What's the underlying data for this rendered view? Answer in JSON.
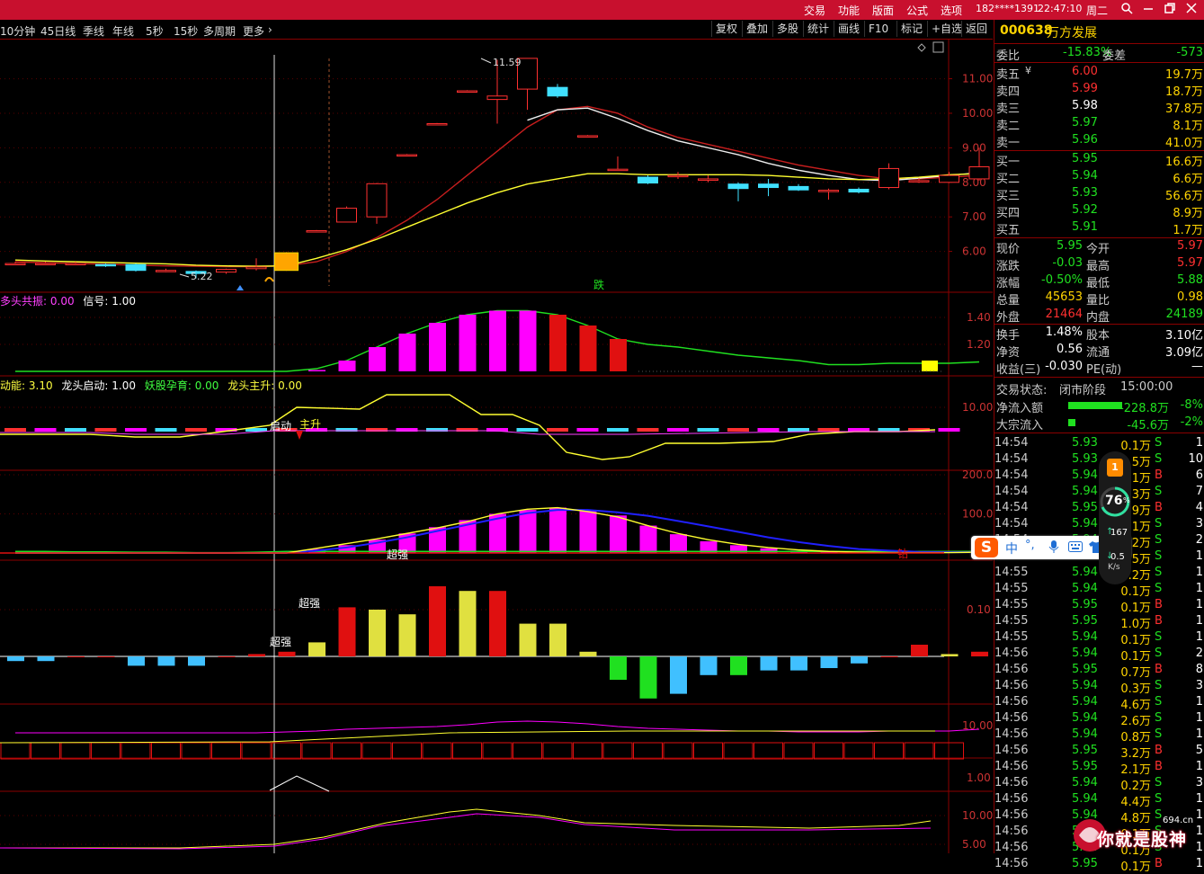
{
  "titlebar": {
    "menus": [
      "交易",
      "功能",
      "版面",
      "公式",
      "选项"
    ],
    "user": "182****1391",
    "time": "22:47:10",
    "weekday": "周二",
    "icons": [
      "search-icon",
      "minimize-icon",
      "restore-icon",
      "close-icon"
    ]
  },
  "periods": [
    "10分钟",
    "45日线",
    "季线",
    "年线",
    "5秒",
    "15秒",
    "多周期",
    "更多"
  ],
  "toolbar_buttons": [
    "复权",
    "叠加",
    "多股",
    "统计",
    "画线",
    "F10",
    "标记",
    "+自选",
    "返回"
  ],
  "stock": {
    "code": "000638",
    "name": "万方发展"
  },
  "weibi": {
    "label1": "委比",
    "v1": "-15.83%",
    "label2": "委差",
    "v2": "-573"
  },
  "asks": [
    {
      "label": "卖五",
      "yen": "¥",
      "price": "6.00",
      "vol": "19.7万"
    },
    {
      "label": "卖四",
      "price": "5.99",
      "vol": "18.7万"
    },
    {
      "label": "卖三",
      "price": "5.98",
      "vol": "37.8万"
    },
    {
      "label": "卖二",
      "price": "5.97",
      "vol": "8.1万"
    },
    {
      "label": "卖一",
      "price": "5.96",
      "vol": "41.0万"
    }
  ],
  "bids": [
    {
      "label": "买一",
      "price": "5.95",
      "vol": "16.6万"
    },
    {
      "label": "买二",
      "price": "5.94",
      "vol": "6.6万"
    },
    {
      "label": "买三",
      "price": "5.93",
      "vol": "56.6万"
    },
    {
      "label": "买四",
      "price": "5.92",
      "vol": "8.9万"
    },
    {
      "label": "买五",
      "price": "5.91",
      "vol": "1.7万"
    }
  ],
  "quote": [
    {
      "l1": "现价",
      "v1": "5.95",
      "l2": "今开",
      "v2": "5.97"
    },
    {
      "l1": "涨跌",
      "v1": "-0.03",
      "l2": "最高",
      "v2": "5.97"
    },
    {
      "l1": "涨幅",
      "v1": "-0.50%",
      "l2": "最低",
      "v2": "5.88"
    },
    {
      "l1": "总量",
      "v1": "45653",
      "l2": "量比",
      "v2": "0.98"
    },
    {
      "l1": "外盘",
      "v1": "21464",
      "l2": "内盘",
      "v2": "24189"
    }
  ],
  "fundamentals": [
    {
      "l1": "换手",
      "v1": "1.48%",
      "l2": "股本",
      "v2": "3.10亿"
    },
    {
      "l1": "净资",
      "v1": "0.56",
      "l2": "流通",
      "v2": "3.09亿"
    },
    {
      "l1": "收益(三)",
      "v1": "-0.030",
      "l2": "PE(动)",
      "v2": "—"
    }
  ],
  "trade_status": {
    "label": "交易状态:",
    "phase": "闭市阶段",
    "time": "15:00:00"
  },
  "flows": [
    {
      "label": "净流入额",
      "value": "-228.8万",
      "pct": "-8%"
    },
    {
      "label": "大宗流入",
      "value": "-45.6万",
      "pct": "-2%"
    }
  ],
  "ticks": [
    {
      "t": "14:54",
      "p": "5.93",
      "v": "0.1万",
      "s": "S",
      "n": "1"
    },
    {
      "t": "14:54",
      "p": "5.93",
      "v": "1.5万",
      "s": "S",
      "n": "10"
    },
    {
      "t": "14:54",
      "p": "5.94",
      "v": "0.1万",
      "s": "B",
      "n": "6"
    },
    {
      "t": "14:54",
      "p": "5.94",
      "v": "0.3万",
      "s": "S",
      "n": "7"
    },
    {
      "t": "14:54",
      "p": "5.95",
      "v": "0.9万",
      "s": "B",
      "n": "4"
    },
    {
      "t": "14:54",
      "p": "5.94",
      "v": "0.1万",
      "s": "S",
      "n": "3"
    },
    {
      "t": "14:54",
      "p": "5.94",
      "v": "0.2万",
      "s": "S",
      "n": "2"
    },
    {
      "t": "14:54",
      "p": "5.94",
      "v": "0.5万",
      "s": "S",
      "n": "1"
    },
    {
      "t": "14:55",
      "p": "5.94",
      "v": "0.2万",
      "s": "S",
      "n": "1"
    },
    {
      "t": "14:55",
      "p": "5.94",
      "v": "0.1万",
      "s": "S",
      "n": "1"
    },
    {
      "t": "14:55",
      "p": "5.95",
      "v": "0.1万",
      "s": "B",
      "n": "1"
    },
    {
      "t": "14:55",
      "p": "5.95",
      "v": "1.0万",
      "s": "B",
      "n": "1"
    },
    {
      "t": "14:55",
      "p": "5.94",
      "v": "0.1万",
      "s": "S",
      "n": "1"
    },
    {
      "t": "14:56",
      "p": "5.94",
      "v": "0.1万",
      "s": "S",
      "n": "2"
    },
    {
      "t": "14:56",
      "p": "5.95",
      "v": "0.7万",
      "s": "B",
      "n": "8"
    },
    {
      "t": "14:56",
      "p": "5.94",
      "v": "0.3万",
      "s": "S",
      "n": "3"
    },
    {
      "t": "14:56",
      "p": "5.94",
      "v": "4.6万",
      "s": "S",
      "n": "1"
    },
    {
      "t": "14:56",
      "p": "5.94",
      "v": "2.6万",
      "s": "S",
      "n": "1"
    },
    {
      "t": "14:56",
      "p": "5.94",
      "v": "0.8万",
      "s": "S",
      "n": "1"
    },
    {
      "t": "14:56",
      "p": "5.95",
      "v": "3.2万",
      "s": "B",
      "n": "5"
    },
    {
      "t": "14:56",
      "p": "5.95",
      "v": "2.1万",
      "s": "B",
      "n": "1"
    },
    {
      "t": "14:56",
      "p": "5.94",
      "v": "0.2万",
      "s": "S",
      "n": "3"
    },
    {
      "t": "14:56",
      "p": "5.94",
      "v": "4.4万",
      "s": "S",
      "n": "1"
    },
    {
      "t": "14:56",
      "p": "5.94",
      "v": "4.8万",
      "s": "S",
      "n": "1"
    },
    {
      "t": "14:56",
      "p": "5.94",
      "v": "0.1万",
      "s": "S",
      "n": "1"
    },
    {
      "t": "14:56",
      "p": "5.94",
      "v": "0.1万",
      "s": "S",
      "n": "1"
    },
    {
      "t": "14:56",
      "p": "5.95",
      "v": "0.1万",
      "s": "B",
      "n": "1"
    }
  ],
  "indicator_labels": {
    "p2": [
      {
        "k": "多头共振:",
        "v": "0.00"
      },
      {
        "k": "信号:",
        "v": "1.00"
      }
    ],
    "p3": [
      {
        "k": "动能:",
        "v": "3.10"
      },
      {
        "k": "龙头启动:",
        "v": "1.00"
      },
      {
        "k": "妖股孕育:",
        "v": "0.00"
      },
      {
        "k": "龙头主升:",
        "v": "0.00"
      }
    ]
  },
  "chart_annotations": {
    "high": "11.59",
    "low": "5.22",
    "fall": "跌",
    "qidong": "启动",
    "zhusheng": "主升",
    "chaoqiang": "超强",
    "zuan": "钻"
  },
  "price_axis": [
    "11.00",
    "10.00",
    "9.00",
    "8.00",
    "7.00",
    "6.00"
  ],
  "p2_axis": [
    "1.40",
    "1.20"
  ],
  "p3_axis": [
    "10.00"
  ],
  "p4_axis": [
    "200.0",
    "100.0"
  ],
  "p5_axis": [
    "0.10"
  ],
  "p6_axis": [
    "10.00"
  ],
  "p7_axis": [
    "1.00"
  ],
  "p8_axis": [
    "10.00",
    "5.00"
  ],
  "sogou": {
    "zh": "中",
    "punct": "°,",
    "icons": [
      "mic-icon",
      "keyboard-icon",
      "skin-icon",
      "apps-icon"
    ]
  },
  "gauge": {
    "badge": "1",
    "percent": "76",
    "unit": "%",
    "speed": "167",
    "speed2": "0.5",
    "speed_unit": "K/s"
  },
  "watermark": {
    "text": "你就是股神",
    "site": "694.cn"
  },
  "colors": {
    "accent": "#c8102e",
    "up": "#ff3030",
    "down": "#20e020",
    "cyan": "#40e0ff",
    "magenta": "#ff00ff",
    "yellow": "#ffff00"
  },
  "chart_data": {
    "type": "candlestick",
    "title": "",
    "y_range": [
      5.0,
      11.9
    ],
    "candles": [
      {
        "o": 5.65,
        "c": 5.65,
        "h": 5.7,
        "l": 5.6
      },
      {
        "o": 5.65,
        "c": 5.65,
        "h": 5.7,
        "l": 5.6
      },
      {
        "o": 5.62,
        "c": 5.65,
        "h": 5.7,
        "l": 5.6
      },
      {
        "o": 5.62,
        "c": 5.58,
        "h": 5.65,
        "l": 5.55
      },
      {
        "o": 5.62,
        "c": 5.45,
        "h": 5.65,
        "l": 5.42
      },
      {
        "o": 5.45,
        "c": 5.45,
        "h": 5.5,
        "l": 5.4
      },
      {
        "o": 5.42,
        "c": 5.36,
        "h": 5.45,
        "l": 5.22
      },
      {
        "o": 5.4,
        "c": 5.48,
        "h": 5.5,
        "l": 5.35
      },
      {
        "o": 5.5,
        "c": 5.55,
        "h": 5.8,
        "l": 5.45
      },
      {
        "o": 5.45,
        "c": 5.96,
        "h": 5.98,
        "l": 5.44
      },
      {
        "o": 6.6,
        "c": 6.6,
        "h": 6.62,
        "l": 6.58
      },
      {
        "o": 6.85,
        "c": 7.25,
        "h": 7.3,
        "l": 6.85
      },
      {
        "o": 7.0,
        "c": 7.96,
        "h": 7.98,
        "l": 6.8
      },
      {
        "o": 8.8,
        "c": 8.8,
        "h": 8.82,
        "l": 8.78
      },
      {
        "o": 9.7,
        "c": 9.7,
        "h": 9.72,
        "l": 9.68
      },
      {
        "o": 10.65,
        "c": 10.65,
        "h": 10.67,
        "l": 10.63
      },
      {
        "o": 10.4,
        "c": 10.5,
        "h": 11.55,
        "l": 9.7
      },
      {
        "o": 10.7,
        "c": 11.59,
        "h": 11.59,
        "l": 10.1
      },
      {
        "o": 10.75,
        "c": 10.5,
        "h": 10.85,
        "l": 10.45
      },
      {
        "o": 9.35,
        "c": 9.35,
        "h": 9.37,
        "l": 9.33
      },
      {
        "o": 8.38,
        "c": 8.38,
        "h": 8.75,
        "l": 8.35
      },
      {
        "o": 8.15,
        "c": 7.98,
        "h": 8.2,
        "l": 7.95
      },
      {
        "o": 8.2,
        "c": 8.2,
        "h": 8.3,
        "l": 8.1
      },
      {
        "o": 8.1,
        "c": 8.1,
        "h": 8.2,
        "l": 8.0
      },
      {
        "o": 7.95,
        "c": 7.82,
        "h": 8.0,
        "l": 7.45
      },
      {
        "o": 7.95,
        "c": 7.85,
        "h": 8.1,
        "l": 7.6
      },
      {
        "o": 7.88,
        "c": 7.78,
        "h": 7.95,
        "l": 7.75
      },
      {
        "o": 7.77,
        "c": 7.77,
        "h": 7.82,
        "l": 7.5
      },
      {
        "o": 7.8,
        "c": 7.72,
        "h": 7.85,
        "l": 7.68
      },
      {
        "o": 7.85,
        "c": 8.4,
        "h": 8.55,
        "l": 7.8
      },
      {
        "o": 8.05,
        "c": 8.05,
        "h": 8.12,
        "l": 7.98
      },
      {
        "o": 8.0,
        "c": 8.2,
        "h": 8.3,
        "l": 7.98
      },
      {
        "o": 8.1,
        "c": 8.45,
        "h": 9.0,
        "l": 8.05
      }
    ],
    "ma_red": [
      5.7,
      5.67,
      5.65,
      5.63,
      5.6,
      5.58,
      5.57,
      5.56,
      5.56,
      5.58,
      5.7,
      6.0,
      6.4,
      6.9,
      7.5,
      8.2,
      8.9,
      9.6,
      10.1,
      10.2,
      10.0,
      9.6,
      9.3,
      9.1,
      8.9,
      8.7,
      8.5,
      8.35,
      8.2,
      8.1,
      8.1,
      8.15,
      8.2
    ],
    "ma_white": [
      null,
      null,
      null,
      null,
      null,
      null,
      null,
      null,
      null,
      null,
      null,
      null,
      null,
      null,
      null,
      null,
      null,
      9.8,
      10.1,
      10.15,
      9.85,
      9.5,
      9.2,
      9.0,
      8.8,
      8.55,
      8.35,
      8.2,
      8.08,
      8.05,
      8.12,
      8.2,
      8.28
    ],
    "ma_yellow": [
      5.75,
      5.72,
      5.7,
      5.68,
      5.66,
      5.64,
      5.6,
      5.58,
      5.57,
      5.58,
      5.8,
      6.05,
      6.35,
      6.7,
      7.05,
      7.4,
      7.7,
      7.95,
      8.1,
      8.25,
      8.25,
      8.22,
      8.22,
      8.22,
      8.22,
      8.2,
      8.15,
      8.1,
      8.08,
      8.1,
      8.15,
      8.22,
      8.25
    ],
    "p2_values": [
      0,
      0,
      0,
      0,
      0,
      0,
      0,
      0,
      0,
      0,
      1.01,
      1.08,
      1.18,
      1.28,
      1.36,
      1.42,
      1.45,
      1.45,
      1.42,
      1.34,
      1.24
    ],
    "p2_colors_red_from": 18,
    "p4_values": [
      0,
      0,
      0,
      0,
      0,
      0,
      0,
      0,
      0,
      0,
      10,
      20,
      34,
      50,
      66,
      84,
      100,
      110,
      116,
      108,
      96,
      70,
      48,
      30,
      20,
      12,
      6,
      3,
      1,
      0,
      0,
      0,
      2
    ],
    "p5_values": [
      -0.01,
      -0.01,
      0,
      0,
      -0.02,
      -0.02,
      -0.02,
      0,
      0.005,
      0.01,
      0.03,
      0.105,
      0.1,
      0.09,
      0.15,
      0.14,
      0.14,
      0.07,
      0.07,
      0.01,
      -0.05,
      -0.09,
      -0.08,
      -0.04,
      -0.04,
      -0.03,
      -0.03,
      -0.025,
      -0.015,
      0,
      0.025,
      0.005,
      0.01,
      0.025
    ]
  }
}
